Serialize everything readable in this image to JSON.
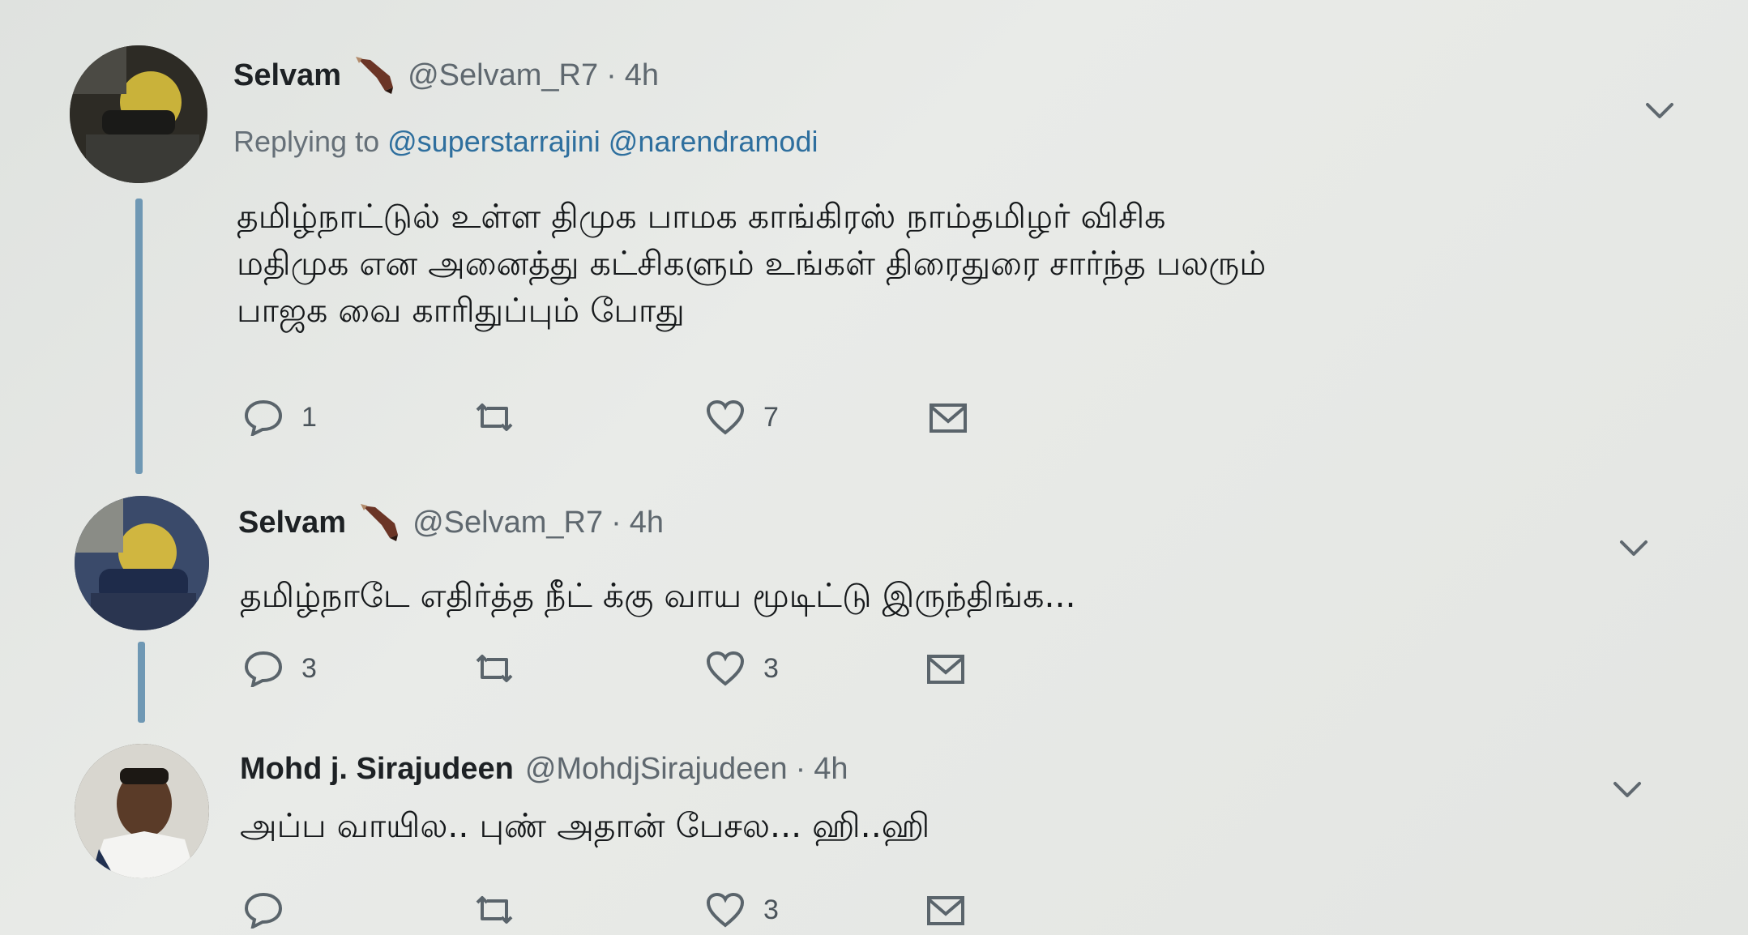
{
  "tweets": [
    {
      "name": "Selvam",
      "handle": "@Selvam_R7",
      "dot": "·",
      "time": "4h",
      "replying_prefix": "Replying to",
      "replying_to": [
        "@superstarrajini",
        "@narendramodi"
      ],
      "text": "தமிழ்நாட்டுல் உள்ள திமுக பாமக காங்கிரஸ் நாம்தமிழர் விசிக\nமதிமுக என அனைத்து கட்சிகளும் உங்கள் திரைதுரை சார்ந்த பலரும்\nபாஜக வை காரிதுப்பும் போது",
      "replies": "1",
      "retweets": "",
      "likes": "7",
      "badge_icon": "pencil-icon"
    },
    {
      "name": "Selvam",
      "handle": "@Selvam_R7",
      "dot": "·",
      "time": "4h",
      "text": "தமிழ்நாடே எதிர்த்த நீட் க்கு வாய மூடிட்டு இருந்திங்க...",
      "replies": "3",
      "retweets": "",
      "likes": "3",
      "badge_icon": "pencil-icon"
    },
    {
      "name": "Mohd j. Sirajudeen",
      "handle": "@MohdjSirajudeen",
      "dot": "·",
      "time": "4h",
      "text": "அப்ப வாயில.. புண் அதான் பேசல... ஹி..ஹி",
      "replies": "",
      "retweets": "",
      "likes": "3"
    }
  ],
  "icons": {
    "reply": "reply-icon",
    "retweet": "retweet-icon",
    "like": "heart-icon",
    "message": "envelope-icon",
    "more": "chevron-down-icon"
  },
  "colors": {
    "thread_line": "#6f98b4",
    "mention": "#2e6f9e",
    "muted": "#5f686f"
  }
}
